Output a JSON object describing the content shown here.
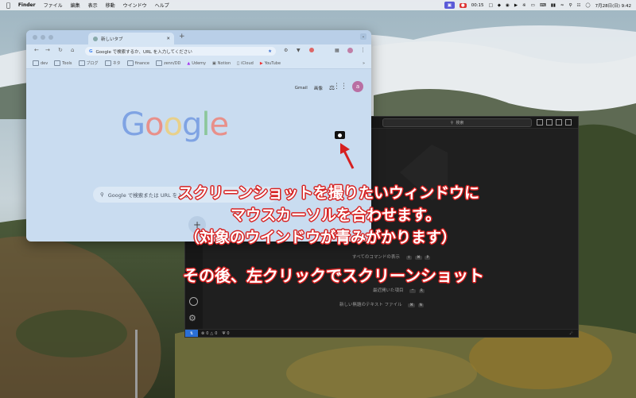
{
  "menubar": {
    "app": "Finder",
    "menus": [
      "ファイル",
      "編集",
      "表示",
      "移動",
      "ウインドウ",
      "ヘルプ"
    ],
    "timer": "00:15",
    "clock": "7月28日(日) 9:42"
  },
  "chrome": {
    "tab_title": "新しいタブ",
    "omnibox_placeholder": "Google で検索するか、URL を入力してください",
    "bookmarks": [
      "dev",
      "Tools",
      "ブログ",
      "ネタ",
      "finance",
      "zenn/DD",
      "Udemy",
      "Notion",
      "iCloud",
      "YouTube"
    ],
    "header_links": [
      "Gmail",
      "画像"
    ],
    "avatar_letter": "a",
    "logo_letters": [
      "G",
      "o",
      "o",
      "g",
      "l",
      "e"
    ],
    "search_placeholder": "Google で検索または URL を入力"
  },
  "vscode": {
    "search_label": "検索",
    "commands": [
      {
        "label": "すべてのコマンドの表示",
        "keys": [
          "⇧",
          "⌘",
          "P"
        ]
      },
      {
        "label": "最近開いた項目",
        "keys": [
          "^",
          "R"
        ]
      },
      {
        "label": "新しい無題のテキスト ファイル",
        "keys": [
          "⌘",
          "N"
        ]
      }
    ],
    "status": {
      "errors": "0",
      "warnings": "0",
      "ports": "0"
    }
  },
  "overlay": {
    "line1": "スクリーンショットを撮りたいウィンドウに",
    "line2": "マウスカーソルを合わせます。",
    "line3": "（対象のウインドウが青みがかります）",
    "line4": "その後、左クリックでスクリーンショット"
  },
  "colors": {
    "overlay_stroke": "#d62020",
    "chrome_tint": "#c9dcf0",
    "vscode_bg": "#1f1f1f",
    "google_blue": "#4285F4",
    "google_red": "#EA4335",
    "google_yellow": "#FBBC05",
    "google_green": "#34A853"
  }
}
